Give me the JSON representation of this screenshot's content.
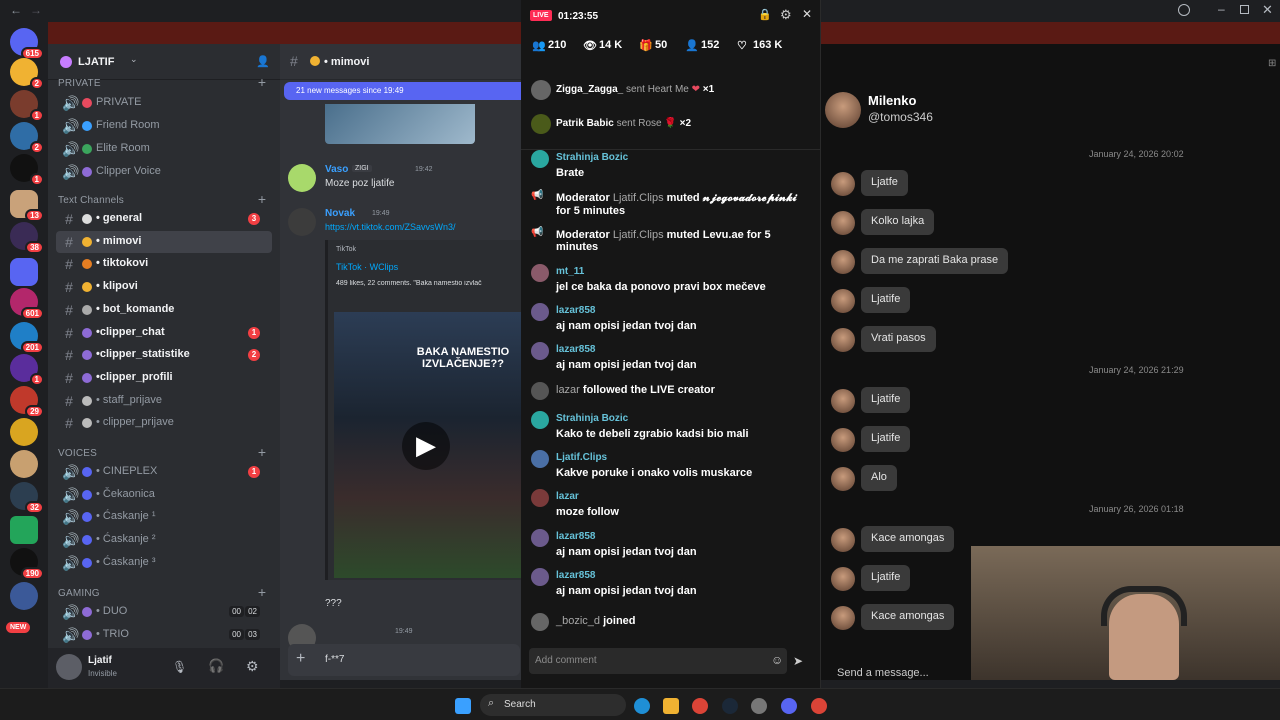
{
  "server": {
    "name": "LJATIF",
    "categories": {
      "private": "PRIVATE",
      "text": "Text Channels",
      "voices": "VOICES",
      "gaming": "GAMING"
    },
    "private_channels": [
      {
        "label": "PRIVATE",
        "color": "#e84a5f"
      },
      {
        "label": "Friend Room",
        "color": "#3aa0ff"
      },
      {
        "label": "Elite Room",
        "color": "#3ba55d"
      },
      {
        "label": "Clipper Voice",
        "color": "#8e6bd6"
      }
    ],
    "text_channels": [
      {
        "label": "• general",
        "badge": "3"
      },
      {
        "label": "• mimovi",
        "badge": ""
      },
      {
        "label": "• tiktokovi",
        "badge": ""
      },
      {
        "label": "• klipovi",
        "badge": ""
      },
      {
        "label": "• bot_komande",
        "badge": ""
      },
      {
        "label": "•clipper_chat",
        "badge": "1"
      },
      {
        "label": "•clipper_statistike",
        "badge": "2"
      },
      {
        "label": "•clipper_profili",
        "badge": ""
      },
      {
        "label": "• staff_prijave",
        "badge": ""
      },
      {
        "label": "• clipper_prijave",
        "badge": ""
      }
    ],
    "voice_channels": [
      {
        "label": "• CINEPLEX",
        "badge": "1"
      },
      {
        "label": "• Čekaonica",
        "badge": ""
      },
      {
        "label": "• Ćaskanje ¹",
        "badge": ""
      },
      {
        "label": "• Ćaskanje ²",
        "badge": ""
      },
      {
        "label": "• Ćaskanje ³",
        "badge": ""
      }
    ],
    "gaming_channels": [
      {
        "label": "• DUO",
        "count_a": "00",
        "count_b": "02"
      },
      {
        "label": "• TRIO",
        "count_a": "00",
        "count_b": "03"
      }
    ]
  },
  "guild_badges": [
    "615",
    "2",
    "1",
    "2",
    "1",
    "13",
    "38",
    "601",
    "201",
    "1",
    "29",
    "32",
    "190"
  ],
  "guild_new": "NEW",
  "user": {
    "name": "Ljatif",
    "status": "Invisible"
  },
  "chat": {
    "channel": "• mimovi",
    "new_messages": "21 new messages since 19:49",
    "messages": [
      {
        "name": "Vaso",
        "tag": "ZIGI",
        "time": "19:42",
        "text": "Moze poz ljatife"
      },
      {
        "name": "Novak",
        "time": "19:49",
        "link": "https://vt.tiktok.com/ZSavvsWn3/"
      }
    ],
    "embed": {
      "provider": "TikTok",
      "title": "TikTok · WClips",
      "desc": "489 likes, 22 comments. \"Baka namestio izvlač",
      "overlay": "BAKA NAMESTIO IZVLAČENJE??"
    },
    "last_text": "???",
    "last_time": "19:49",
    "composer_text": "f-**7"
  },
  "live": {
    "badge": "LIVE",
    "timer": "01:23:55",
    "stats": [
      "210",
      "14 K",
      "50",
      "152",
      "163 K"
    ],
    "gifts": [
      {
        "user": "Zigga_Zagga_",
        "action": "sent Heart Me",
        "count": "×1"
      },
      {
        "user": "Patrik Babic",
        "action": "sent Rose",
        "count": "×2"
      }
    ],
    "feed": [
      {
        "kind": "comment",
        "name": "Strahinja Bozic",
        "text": "Brate"
      },
      {
        "kind": "mod",
        "text": "Moderator",
        "mid": "Ljatif.Clips",
        "action": "muted",
        "target": "𝓷𝓳𝓮𝓰𝓸𝓿𝓪𝓭𝓸𝓻𝓮𝓹𝓲𝓷𝓴𝓲",
        "suffix": "for 5 minutes"
      },
      {
        "kind": "mod",
        "text": "Moderator",
        "mid": "Ljatif.Clips",
        "action": "muted",
        "target": "Levu.ae",
        "suffix": "for 5 minutes"
      },
      {
        "kind": "comment",
        "name": "mt_11",
        "text": "jel ce baka da ponovo pravi box mečeve"
      },
      {
        "kind": "comment",
        "name": "lazar858",
        "text": "aj nam opisi jedan tvoj dan"
      },
      {
        "kind": "comment",
        "name": "lazar858",
        "text": "aj nam opisi jedan tvoj dan"
      },
      {
        "kind": "follow",
        "name": "lazar",
        "text": "followed the LIVE creator"
      },
      {
        "kind": "comment",
        "name": "Strahinja Bozic",
        "text": "Kako te debeli zgrabio kadsi bio mali"
      },
      {
        "kind": "comment",
        "name": "Ljatif.Clips",
        "text": "Kakve poruke i onako volis muskarce"
      },
      {
        "kind": "comment",
        "name": "lazar",
        "text": "moze follow"
      },
      {
        "kind": "comment",
        "name": "lazar858",
        "text": "aj nam opisi jedan tvoj dan"
      },
      {
        "kind": "comment",
        "name": "lazar858",
        "text": "aj nam opisi jedan tvoj dan"
      },
      {
        "kind": "join",
        "name": "_bozic_d",
        "text": "joined"
      }
    ],
    "comment_placeholder": "Add comment"
  },
  "dm": {
    "name": "Milenko",
    "handle": "@tomos346",
    "dates": [
      "January 24, 2026 20:02",
      "January 24, 2026 21:29",
      "January 26, 2026 01:18"
    ],
    "group1": [
      "Ljatfe",
      "Kolko lajka",
      "Da me zaprati Baka prase",
      "Ljatife",
      "Vrati pasos"
    ],
    "group2": [
      "Ljatife",
      "Ljatife",
      "Alo"
    ],
    "group3": [
      "Kace amongas",
      "Ljatife",
      "Kace amongas"
    ],
    "input_placeholder": "Send a message..."
  },
  "taskbar": {
    "search": "Search"
  }
}
